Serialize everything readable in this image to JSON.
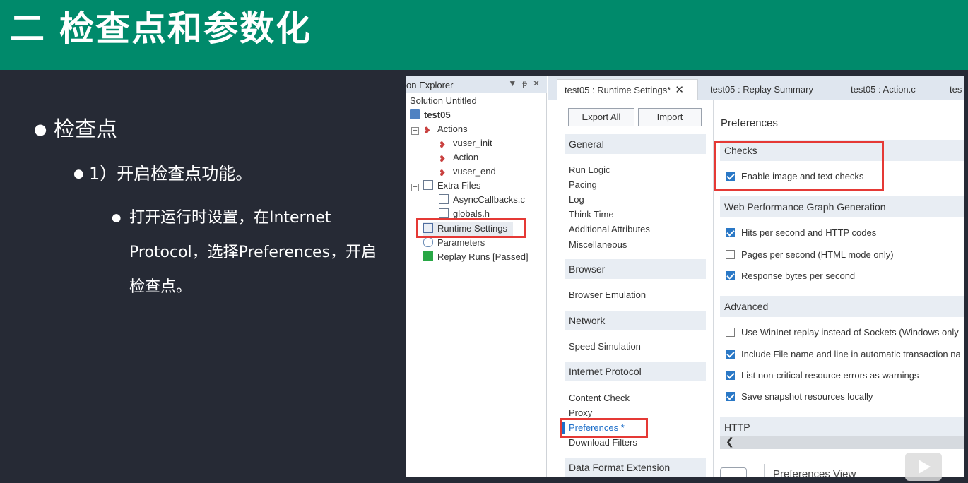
{
  "slide": {
    "title": "二  检查点和参数化",
    "bullet1": "检查点",
    "bullet2": "1）开启检查点功能。",
    "bullet3": "打开运行时设置，在Internet Protocol，选择Preferences，开启检查点。"
  },
  "explorer": {
    "title": "on Explorer",
    "controls": [
      "▼",
      "ᵽ",
      "✕"
    ],
    "tree": {
      "solution": "Solution Untitled",
      "script": "test05",
      "actions": "Actions",
      "vuser_init": "vuser_init",
      "action": "Action",
      "vuser_end": "vuser_end",
      "extra_files": "Extra Files",
      "async": "AsyncCallbacks.c",
      "globals": "globals.h",
      "runtime": "Runtime Settings",
      "parameters": "Parameters",
      "replay": "Replay Runs [Passed]"
    }
  },
  "tabs": {
    "runtime": "test05 : Runtime Settings*",
    "replay_summary": "test05 : Replay Summary",
    "action_c": "test05 : Action.c",
    "overflow": "tes",
    "close": "✕"
  },
  "buttons": {
    "export_all": "Export All",
    "import": "Import"
  },
  "nav": {
    "general": "General",
    "run_logic": "Run Logic",
    "pacing": "Pacing",
    "log": "Log",
    "think_time": "Think Time",
    "additional_attributes": "Additional Attributes",
    "miscellaneous": "Miscellaneous",
    "browser": "Browser",
    "browser_emulation": "Browser Emulation",
    "network": "Network",
    "speed_simulation": "Speed Simulation",
    "internet_protocol": "Internet Protocol",
    "content_check": "Content Check",
    "proxy": "Proxy",
    "preferences": "Preferences *",
    "download_filters": "Download Filters",
    "data_format_extension": "Data Format Extension"
  },
  "preferences": {
    "title": "Preferences",
    "checks_group": "Checks",
    "enable_checks": {
      "label": "Enable image and text checks",
      "checked": true
    },
    "wpg_group": "Web Performance Graph Generation",
    "hits": {
      "label": "Hits per second and HTTP codes",
      "checked": true
    },
    "pages": {
      "label": "Pages per second (HTML mode only)",
      "checked": false
    },
    "response": {
      "label": "Response bytes per second",
      "checked": true
    },
    "advanced_group": "Advanced",
    "wininet": {
      "label": "Use WinInet replay instead of Sockets (Windows only",
      "checked": false
    },
    "include_file": {
      "label": "Include File name and line in automatic transaction na",
      "checked": true
    },
    "non_critical": {
      "label": "List non-critical resource errors as warnings",
      "checked": true
    },
    "snapshot": {
      "label": "Save snapshot resources locally",
      "checked": true
    },
    "http_group": "HTTP",
    "scroll_left": "❮",
    "preferences_view": "Preferences View"
  },
  "colors": {
    "header_green": "#008a6b",
    "slide_bg": "#262a35",
    "highlight_red": "#e53935",
    "link_blue": "#1e6fc9",
    "checkbox_blue": "#2a78c6"
  }
}
